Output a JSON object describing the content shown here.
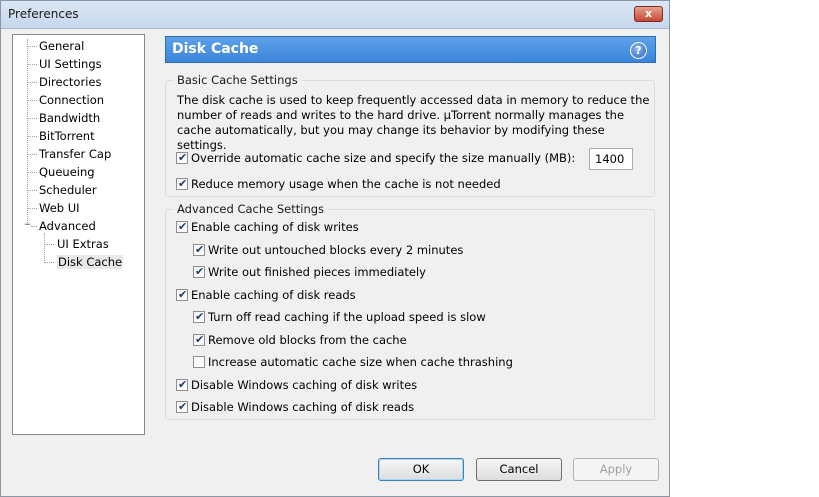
{
  "window": {
    "title": "Preferences",
    "close_label": "x"
  },
  "tree": {
    "items": [
      {
        "label": "General"
      },
      {
        "label": "UI Settings"
      },
      {
        "label": "Directories"
      },
      {
        "label": "Connection"
      },
      {
        "label": "Bandwidth"
      },
      {
        "label": "BitTorrent"
      },
      {
        "label": "Transfer Cap"
      },
      {
        "label": "Queueing"
      },
      {
        "label": "Scheduler"
      },
      {
        "label": "Web UI"
      },
      {
        "label": "Advanced"
      },
      {
        "label": "UI Extras"
      },
      {
        "label": "Disk Cache"
      }
    ],
    "selected": "Disk Cache",
    "expander": "−"
  },
  "header": {
    "title": "Disk Cache",
    "help": "?"
  },
  "basic": {
    "label": "Basic Cache Settings",
    "description": "The disk cache is used to keep frequently accessed data in memory to reduce the number of reads and writes to the hard drive. µTorrent normally manages the cache automatically, but you may change its behavior by modifying these settings.",
    "override": {
      "label": "Override automatic cache size and specify the size manually (MB):",
      "checked": true
    },
    "size_value": "1400",
    "reduce": {
      "label": "Reduce memory usage when the cache is not needed",
      "checked": true
    }
  },
  "advanced": {
    "label": "Advanced Cache Settings",
    "options": [
      {
        "label": "Enable caching of disk writes",
        "checked": true
      },
      {
        "label": "Write out untouched blocks every 2 minutes",
        "checked": true
      },
      {
        "label": "Write out finished pieces immediately",
        "checked": true
      },
      {
        "label": "Enable caching of disk reads",
        "checked": true
      },
      {
        "label": "Turn off read caching if the upload speed is slow",
        "checked": true
      },
      {
        "label": "Remove old blocks from the cache",
        "checked": true
      },
      {
        "label": "Increase automatic cache size when cache thrashing",
        "checked": false
      },
      {
        "label": "Disable Windows caching of disk writes",
        "checked": true
      },
      {
        "label": "Disable Windows caching of disk reads",
        "checked": true
      }
    ]
  },
  "buttons": {
    "ok": "OK",
    "cancel": "Cancel",
    "apply": "Apply"
  }
}
